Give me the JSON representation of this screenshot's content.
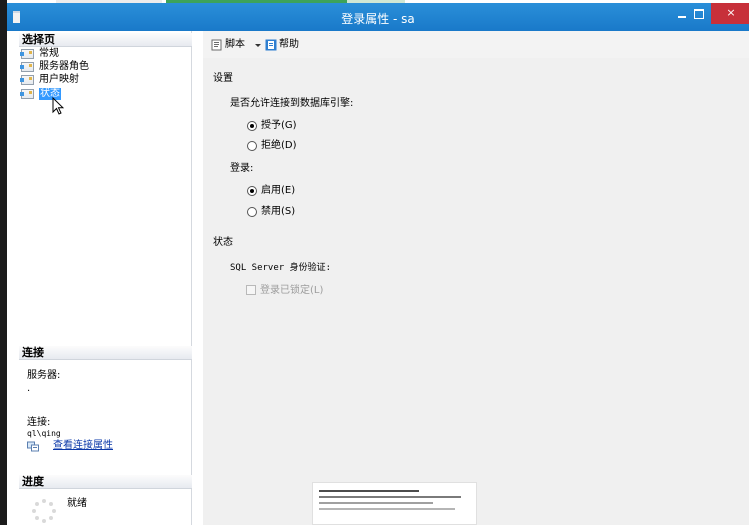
{
  "window": {
    "title": "登录属性 - sa",
    "close_glyph": "×"
  },
  "left_pane": {
    "select_page_title": "选择页",
    "pages": [
      {
        "label": "常规"
      },
      {
        "label": "服务器角色"
      },
      {
        "label": "用户映射"
      },
      {
        "label": "状态"
      }
    ],
    "connection": {
      "title": "连接",
      "server_label": "服务器:",
      "server_value": ".",
      "connection_label": "连接:",
      "connection_value": "ql\\qing",
      "link_label": "查看连接属性"
    },
    "progress": {
      "title": "进度",
      "status": "就绪"
    }
  },
  "toolbar": {
    "script_label": "脚本",
    "help_label": "帮助"
  },
  "settings": {
    "title": "设置",
    "allow_connect_label": "是否允许连接到数据库引擎:",
    "grant_label": "授予(G)",
    "deny_label": "拒绝(D)",
    "login_label": "登录:",
    "enable_label": "启用(E)",
    "disable_label": "禁用(S)"
  },
  "status": {
    "title": "状态",
    "sql_auth_label": "SQL Server 身份验证:",
    "locked_label": "登录已锁定(L)"
  }
}
